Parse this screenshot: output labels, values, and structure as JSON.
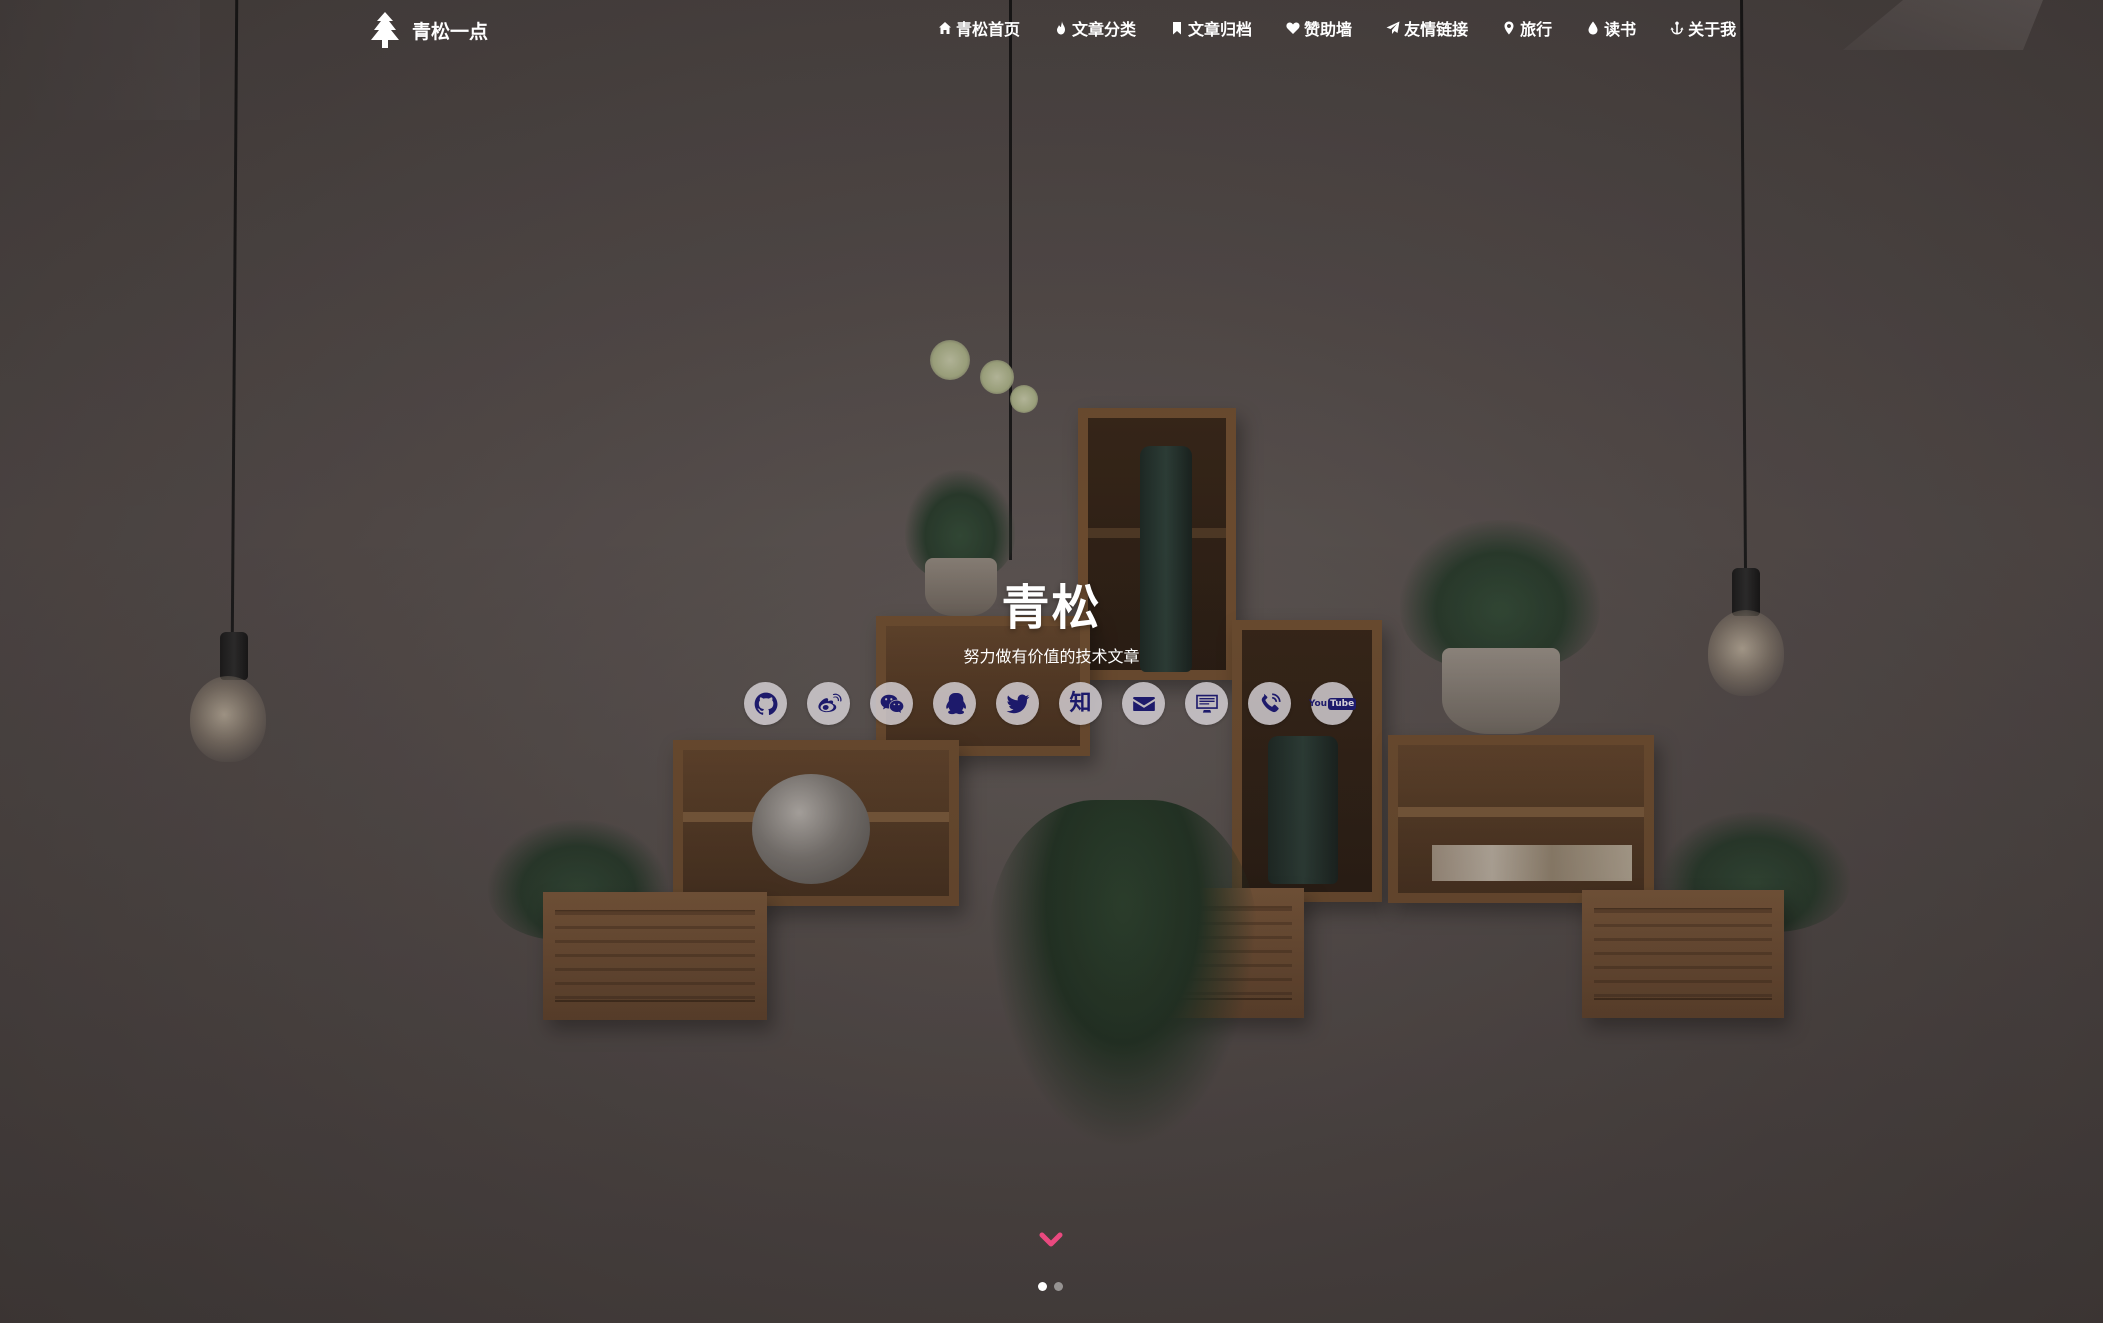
{
  "brand": {
    "name": "青松一点",
    "icon": "pine-tree-icon"
  },
  "nav": {
    "items": [
      {
        "label": "青松首页",
        "icon": "home-icon"
      },
      {
        "label": "文章分类",
        "icon": "fire-icon"
      },
      {
        "label": "文章归档",
        "icon": "bookmark-icon"
      },
      {
        "label": "赞助墙",
        "icon": "heart-icon"
      },
      {
        "label": "友情链接",
        "icon": "paper-plane-icon"
      },
      {
        "label": "旅行",
        "icon": "map-marker-icon"
      },
      {
        "label": "读书",
        "icon": "drop-icon"
      },
      {
        "label": "关于我",
        "icon": "anchor-icon"
      }
    ]
  },
  "hero": {
    "title": "青松",
    "subtitle": "努力做有价值的技术文章"
  },
  "social": {
    "icon_color": "#1d1a6b",
    "items": [
      {
        "name": "github-icon"
      },
      {
        "name": "weibo-icon"
      },
      {
        "name": "wechat-icon"
      },
      {
        "name": "qq-icon"
      },
      {
        "name": "twitter-icon"
      },
      {
        "name": "zhihu-icon",
        "text": "知"
      },
      {
        "name": "email-icon"
      },
      {
        "name": "desktop-icon"
      },
      {
        "name": "phone-icon"
      },
      {
        "name": "youtube-icon",
        "text_you": "You",
        "text_tube": "Tube"
      }
    ]
  },
  "scroll_indicator": {
    "icon": "chevron-down-icon",
    "color": "#e9497f"
  },
  "carousel": {
    "pages": 2,
    "active": 1
  }
}
